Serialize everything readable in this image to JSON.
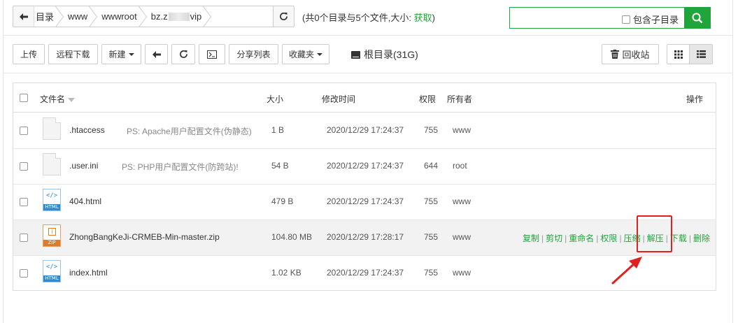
{
  "breadcrumb": {
    "items": [
      "目录",
      "www",
      "wwwroot",
      "bz.z",
      "vip"
    ]
  },
  "summary": {
    "text": "(共0个目录与5个文件,大小: ",
    "fetch": "获取",
    "close": ")"
  },
  "search": {
    "subdir_label": "包含子目录",
    "value": ""
  },
  "toolbar": {
    "upload": "上传",
    "remote_download": "远程下载",
    "new": "新建",
    "share_list": "分享列表",
    "favorites": "收藏夹",
    "root_dir": "根目录(31G)",
    "recycle_bin": "回收站"
  },
  "table": {
    "headers": {
      "name": "文件名",
      "size": "大小",
      "mtime": "修改时间",
      "perm": "权限",
      "owner": "所有者",
      "ops": "操作"
    },
    "rows": [
      {
        "name": ".htaccess",
        "ps": "PS: Apache用户配置文件(伪静态)",
        "size": "1 B",
        "mtime": "2020/12/29 17:24:37",
        "perm": "755",
        "owner": "www",
        "icon": "file-icon"
      },
      {
        "name": ".user.ini",
        "ps": "PS: PHP用户配置文件(防跨站)!",
        "size": "54 B",
        "mtime": "2020/12/29 17:24:37",
        "perm": "644",
        "owner": "root",
        "icon": "file-icon"
      },
      {
        "name": "404.html",
        "ps": "",
        "size": "479 B",
        "mtime": "2020/12/29 17:24:37",
        "perm": "755",
        "owner": "www",
        "icon": "html-icon"
      },
      {
        "name": "ZhongBangKeJi-CRMEB-Min-master.zip",
        "ps": "",
        "size": "104.80 MB",
        "mtime": "2020/12/29 17:28:17",
        "perm": "755",
        "owner": "www",
        "icon": "zip-icon"
      },
      {
        "name": "index.html",
        "ps": "",
        "size": "1.02 KB",
        "mtime": "2020/12/29 17:24:37",
        "perm": "755",
        "owner": "www",
        "icon": "html-icon"
      }
    ],
    "row_ops": [
      "复制",
      "剪切",
      "重命名",
      "权限",
      "压缩",
      "解压",
      "下载",
      "删除"
    ]
  },
  "icons": {
    "html_code": "</>",
    "html_tag": "HTML",
    "zip_code": "i",
    "zip_tag": "ZIP"
  },
  "colors": {
    "accent": "#20a53a",
    "annotation": "#e32020",
    "html_icon": "#2f8ad0",
    "zip_icon": "#e07b28"
  }
}
